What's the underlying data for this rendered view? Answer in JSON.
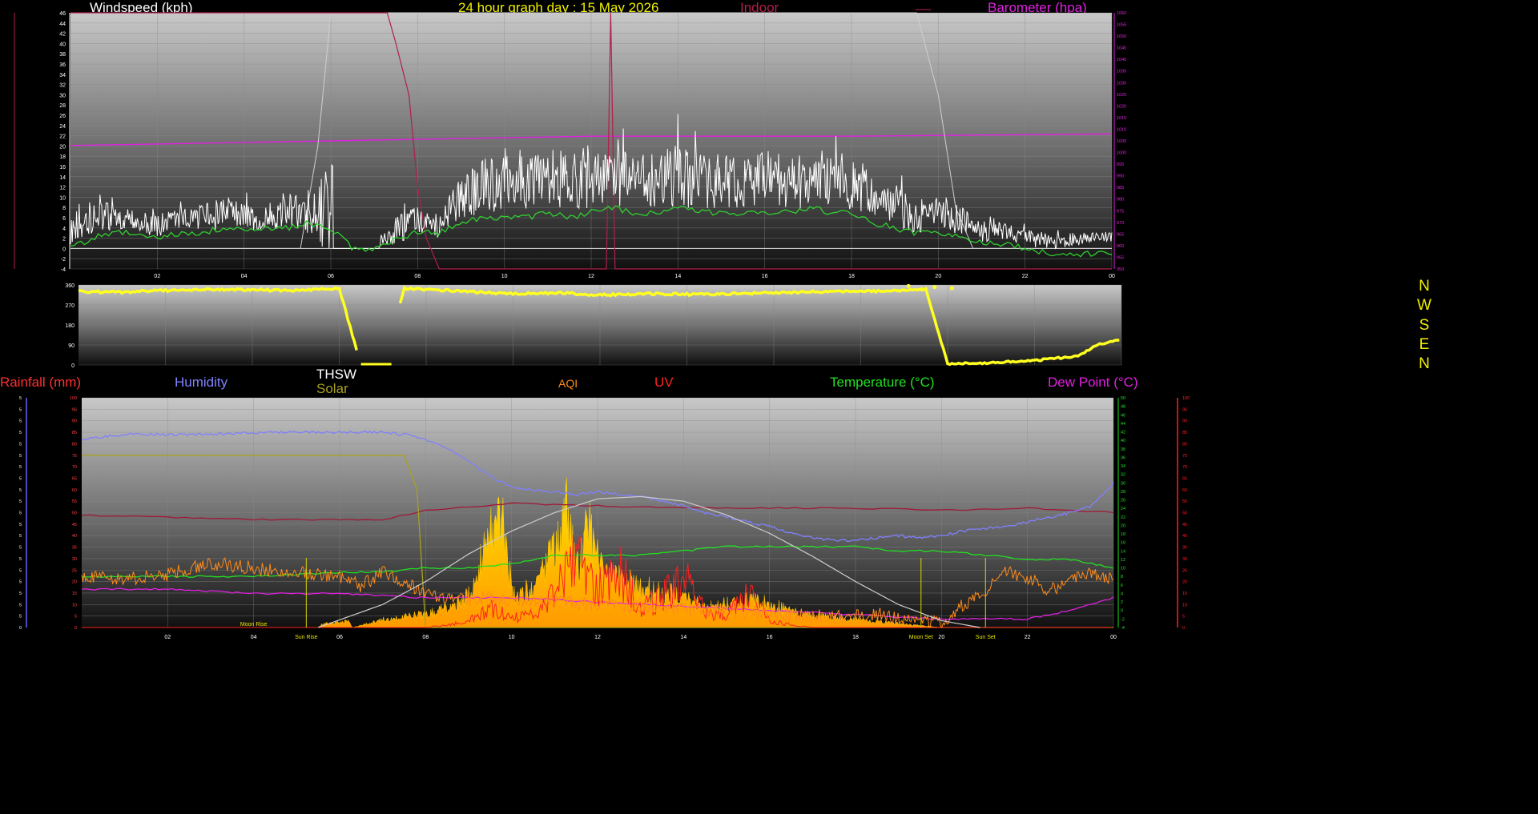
{
  "header": {
    "windspeed_label": "Windspeed (kph)",
    "graph_title": "24 hour graph day : 15 May 2026",
    "indoor_label": "Indoor",
    "indoor_dash": "__",
    "barometer_label": "Barometer (hpa)"
  },
  "legend": {
    "rainfall": "Rainfall (mm)",
    "humidity": "Humidity",
    "thsw": "THSW",
    "solar": "Solar",
    "aqi": "AQI",
    "uv": "UV",
    "temperature": "Temperature (°C)",
    "dewpoint": "Dew Point (°C)"
  },
  "compass": [
    "N",
    "W",
    "S",
    "E",
    "N"
  ],
  "events": {
    "moon_rise": "Moon Rise",
    "sun_rise": "Sun Rise",
    "moon_set": "Moon Set",
    "sun_set": "Sun Set"
  },
  "colors": {
    "windspeed": "#ffffff",
    "gust": "#bbbbbb",
    "wind_avg": "#2fcf2f",
    "indoor": "#b0204a",
    "barometer": "#e020e0",
    "title": "#f0f000",
    "direction": "#ffff20",
    "humidity": "#8080ff",
    "solar": "#aaa020",
    "aqi": "#ff8c1a",
    "uv": "#ff2020",
    "temperature": "#20e020",
    "dewpoint": "#e020e0",
    "sunpath": "#cccccc",
    "rainfall": "#ff3030"
  },
  "chart_data": [
    {
      "type": "line",
      "title": "24 hour graph day : 15 May 2026",
      "x_ticks": [
        "02",
        "04",
        "06",
        "08",
        "10",
        "12",
        "14",
        "16",
        "18",
        "20",
        "22",
        "00"
      ],
      "x_range_hours": [
        0,
        24
      ],
      "y_left_label": "Windspeed (kph)",
      "y_left_range": [
        -4,
        46
      ],
      "y_left_ticks": [
        46,
        44,
        42,
        40,
        38,
        36,
        34,
        32,
        30,
        28,
        26,
        24,
        22,
        20,
        18,
        16,
        14,
        12,
        10,
        8,
        6,
        4,
        2,
        0,
        -2,
        -4
      ],
      "y_right_label": "Barometer (hpa)",
      "y_right_range": [
        950,
        1060
      ],
      "y_right_ticks": [
        1060,
        1055,
        1050,
        1045,
        1040,
        1035,
        1030,
        1025,
        1020,
        1015,
        1010,
        1005,
        1000,
        995,
        990,
        985,
        980,
        975,
        970,
        965,
        960,
        955,
        950
      ],
      "series": [
        {
          "name": "Windspeed (kph)",
          "x": [
            0,
            0.5,
            1,
            1.5,
            2,
            2.5,
            3,
            3.5,
            4,
            4.5,
            5,
            5.5,
            6,
            6.5,
            7,
            7.5,
            8,
            8.5,
            9,
            9.5,
            10,
            10.5,
            11,
            11.5,
            12,
            12.5,
            13,
            13.5,
            14,
            14.5,
            15,
            15.5,
            16,
            16.5,
            17,
            17.5,
            18,
            18.5,
            19,
            19.5,
            20,
            20.5,
            21,
            21.5,
            22,
            22.5,
            23,
            23.5,
            24
          ],
          "y": [
            3,
            5,
            6,
            5,
            4,
            6,
            5,
            6,
            6,
            5,
            7,
            5,
            6,
            0,
            0,
            3,
            5,
            4,
            9,
            11,
            12,
            12,
            13,
            12,
            12,
            13,
            12,
            13,
            13,
            12,
            12,
            12,
            13,
            12,
            12,
            13,
            12,
            10,
            8,
            5,
            6,
            5,
            3,
            3,
            2,
            1,
            1,
            2,
            2
          ]
        },
        {
          "name": "Gust",
          "x": [
            0,
            0.5,
            1,
            1.5,
            2,
            2.5,
            3,
            3.5,
            4,
            4.5,
            5,
            5.5,
            6,
            6.5,
            7,
            7.5,
            8,
            8.5,
            9,
            9.5,
            10,
            10.5,
            11,
            11.5,
            12,
            12.5,
            13,
            13.5,
            14,
            14.5,
            15,
            15.5,
            16,
            16.5,
            17,
            17.5,
            18,
            18.5,
            19,
            19.5,
            20,
            20.5,
            21,
            21.5,
            22,
            22.5,
            23,
            23.5,
            24
          ],
          "y": [
            8,
            10,
            11,
            9,
            8,
            11,
            10,
            12,
            11,
            10,
            14,
            11,
            24,
            0,
            0,
            8,
            10,
            9,
            17,
            22,
            21,
            22,
            24,
            22,
            22,
            23,
            22,
            24,
            25,
            22,
            22,
            21,
            23,
            21,
            22,
            23,
            22,
            18,
            15,
            11,
            12,
            10,
            7,
            6,
            5,
            4,
            3,
            4,
            4
          ]
        },
        {
          "name": "Wind average",
          "x": [
            0,
            0.5,
            1,
            1.5,
            2,
            2.5,
            3,
            3.5,
            4,
            4.5,
            5,
            5.5,
            6,
            6.5,
            7,
            7.5,
            8,
            8.5,
            9,
            9.5,
            10,
            10.5,
            11,
            11.5,
            12,
            12.5,
            13,
            13.5,
            14,
            14.5,
            15,
            15.5,
            16,
            16.5,
            17,
            17.5,
            18,
            18.5,
            19,
            19.5,
            20,
            20.5,
            21,
            21.5,
            22,
            22.5,
            23,
            23.5,
            24
          ],
          "y": [
            0,
            2,
            3,
            3,
            2,
            3,
            3,
            4,
            4,
            4,
            4,
            5,
            4,
            0,
            0,
            2,
            3,
            3,
            5,
            6,
            6,
            6,
            7,
            6,
            7,
            8,
            7,
            7,
            8,
            7,
            7,
            7,
            7,
            7,
            8,
            7,
            7,
            5,
            4,
            3,
            3,
            2,
            1,
            1,
            0,
            -1,
            -1,
            -1,
            -1
          ]
        },
        {
          "name": "Indoor",
          "x": [
            0,
            7.3,
            7.5,
            7.8,
            8.0,
            8.2,
            8.5,
            12.35,
            12.45,
            12.55,
            24
          ],
          "y": [
            46,
            46,
            40,
            30,
            12,
            2,
            -4,
            -4,
            46,
            -4,
            -4
          ]
        },
        {
          "name": "Barometer (hpa)",
          "axis": "right",
          "x": [
            0,
            6,
            12,
            18,
            24
          ],
          "y": [
            1003,
            1005,
            1007,
            1007,
            1008
          ]
        },
        {
          "name": "Gray trend",
          "x": [
            0,
            5.3,
            5.7,
            6.0,
            19.5,
            20.0,
            20.4,
            20.8,
            24
          ],
          "y": [
            0,
            0,
            20,
            46,
            46,
            30,
            8,
            0,
            0
          ]
        }
      ]
    },
    {
      "type": "scatter",
      "title": "",
      "x_range_hours": [
        0,
        24
      ],
      "y_range": [
        0,
        360
      ],
      "y_ticks": [
        360,
        270,
        180,
        90,
        0
      ],
      "series": [
        {
          "name": "Wind direction",
          "x": [
            0,
            1,
            2,
            3,
            4,
            5,
            6,
            6.5,
            7,
            7.5,
            8,
            9,
            10,
            11,
            12,
            13,
            14,
            15,
            16,
            17,
            18,
            19,
            19.5,
            20,
            21,
            22,
            23,
            23.5,
            24
          ],
          "y": [
            330,
            328,
            335,
            340,
            338,
            335,
            345,
            0,
            0,
            345,
            340,
            330,
            320,
            325,
            315,
            320,
            318,
            320,
            325,
            330,
            330,
            335,
            340,
            5,
            10,
            20,
            40,
            95,
            115
          ]
        }
      ]
    },
    {
      "type": "area",
      "title": "",
      "x_ticks": [
        "02",
        "04",
        "06",
        "08",
        "10",
        "12",
        "14",
        "16",
        "18",
        "20",
        "22",
        "00"
      ],
      "x_range_hours": [
        0,
        24
      ],
      "y_left_range": [
        0,
        100
      ],
      "y_left_ticks": [
        100,
        95,
        90,
        85,
        80,
        75,
        70,
        65,
        60,
        55,
        50,
        45,
        40,
        35,
        30,
        25,
        20,
        15,
        10,
        5,
        0
      ],
      "y_right_range": [
        -4,
        50
      ],
      "y_right_ticks": [
        50,
        48,
        46,
        44,
        42,
        40,
        38,
        36,
        34,
        32,
        30,
        28,
        26,
        24,
        22,
        20,
        18,
        16,
        14,
        12,
        10,
        8,
        6,
        4,
        2,
        0,
        -2,
        -4
      ],
      "y_rain_ticks": [
        5,
        5,
        5,
        5,
        5,
        5,
        5,
        5,
        5,
        5,
        5,
        5,
        5,
        5,
        5,
        5,
        5,
        5,
        5,
        5,
        0
      ],
      "series": [
        {
          "name": "Humidity",
          "x": [
            0,
            1,
            2,
            3,
            4,
            5,
            6,
            7,
            7.5,
            8,
            8.5,
            9,
            9.5,
            10,
            10.5,
            11,
            11.5,
            12,
            12.5,
            13,
            13.5,
            14,
            14.5,
            15,
            15.5,
            16,
            16.5,
            17,
            17.5,
            18,
            18.5,
            19,
            19.5,
            20,
            20.5,
            21,
            21.5,
            22,
            22.5,
            23,
            23.5,
            24
          ],
          "y": [
            82,
            84,
            84,
            84,
            85,
            85,
            85,
            85,
            84,
            82,
            78,
            72,
            66,
            61,
            60,
            59,
            58,
            59,
            58,
            57,
            55,
            53,
            50,
            48,
            46,
            44,
            41,
            39,
            38,
            38,
            39,
            40,
            39,
            40,
            42,
            43,
            44,
            46,
            48,
            50,
            53,
            63
          ]
        },
        {
          "name": "Solar",
          "x": [
            0,
            6.5,
            7.5,
            7.6,
            7.8,
            8,
            24
          ],
          "y": [
            75,
            75,
            75,
            70,
            60,
            0,
            0
          ]
        },
        {
          "name": "AQI",
          "x": [
            0,
            1,
            2,
            3,
            4,
            5,
            6,
            6.5,
            7,
            7.5,
            8,
            8.5,
            9,
            9.5,
            10,
            11,
            12,
            13,
            14,
            15,
            16,
            17,
            18,
            18.5,
            19,
            19.5,
            20,
            20.5,
            21,
            21.5,
            22,
            22.5,
            23,
            23.5,
            24
          ],
          "y": [
            22,
            21,
            23,
            28,
            26,
            24,
            22,
            18,
            24,
            20,
            15,
            13,
            12,
            13,
            12,
            11,
            10,
            9,
            8,
            7,
            6,
            5,
            5,
            6,
            4,
            3,
            2,
            10,
            16,
            24,
            22,
            16,
            20,
            24,
            21
          ]
        },
        {
          "name": "UV",
          "x": [
            0,
            8,
            9,
            9.5,
            10,
            10.5,
            11,
            11.5,
            12,
            12.5,
            13,
            13.5,
            14,
            14.5,
            15,
            15.5,
            16,
            17,
            24
          ],
          "y": [
            0,
            0,
            3,
            10,
            5,
            6,
            18,
            35,
            20,
            30,
            10,
            15,
            25,
            8,
            6,
            18,
            3,
            0,
            0
          ]
        },
        {
          "name": "Temperature (°C)",
          "axis": "right",
          "x": [
            0,
            2,
            4,
            6,
            7,
            8,
            9,
            10,
            11,
            12,
            13,
            14,
            15,
            16,
            17,
            18,
            19,
            20,
            21,
            22,
            23,
            24
          ],
          "y": [
            8,
            8,
            8,
            9,
            9,
            10,
            10,
            11,
            13,
            13,
            13,
            14,
            15,
            15,
            15,
            15,
            14,
            14,
            13,
            12,
            12,
            10
          ]
        },
        {
          "name": "Dew Point (°C)",
          "axis": "right",
          "x": [
            0,
            2,
            4,
            6,
            8,
            10,
            12,
            14,
            16,
            18,
            20,
            22,
            23,
            24
          ],
          "y": [
            5,
            5,
            4,
            4,
            3,
            3,
            2,
            1,
            0,
            -1,
            -2,
            -2,
            0,
            3
          ]
        },
        {
          "name": "THSW",
          "x": [
            0,
            2,
            4,
            6,
            7,
            8,
            10,
            12,
            14,
            16,
            18,
            20,
            22,
            24
          ],
          "y": [
            49,
            48,
            47,
            47,
            47,
            51,
            54,
            53,
            52,
            52,
            52,
            51,
            52,
            50
          ]
        },
        {
          "name": "Solar radiation",
          "x": [
            0,
            5.5,
            5.6,
            6.2,
            6.3,
            7,
            8,
            8.5,
            9,
            9.5,
            9.8,
            10,
            10.5,
            11,
            11.3,
            11.5,
            11.8,
            12,
            12.3,
            12.5,
            13,
            13.5,
            14,
            14.5,
            15,
            15.5,
            16,
            16.5,
            17,
            17.5,
            18,
            18.5,
            19,
            19.5,
            20,
            20.5,
            24
          ],
          "y": [
            0,
            0,
            2,
            3,
            0,
            4,
            7,
            10,
            18,
            45,
            58,
            18,
            18,
            40,
            62,
            30,
            50,
            35,
            30,
            25,
            20,
            18,
            15,
            10,
            12,
            14,
            12,
            8,
            6,
            5,
            4,
            3,
            2,
            1,
            0,
            0,
            0
          ]
        },
        {
          "name": "Sun path",
          "x": [
            5.5,
            7,
            8,
            9,
            10,
            11,
            12,
            13,
            14,
            15,
            16,
            17,
            18,
            19,
            20,
            20.9
          ],
          "y": [
            0,
            10,
            20,
            32,
            42,
            50,
            56,
            57,
            55,
            49,
            41,
            31,
            20,
            10,
            3,
            0
          ]
        }
      ]
    }
  ]
}
